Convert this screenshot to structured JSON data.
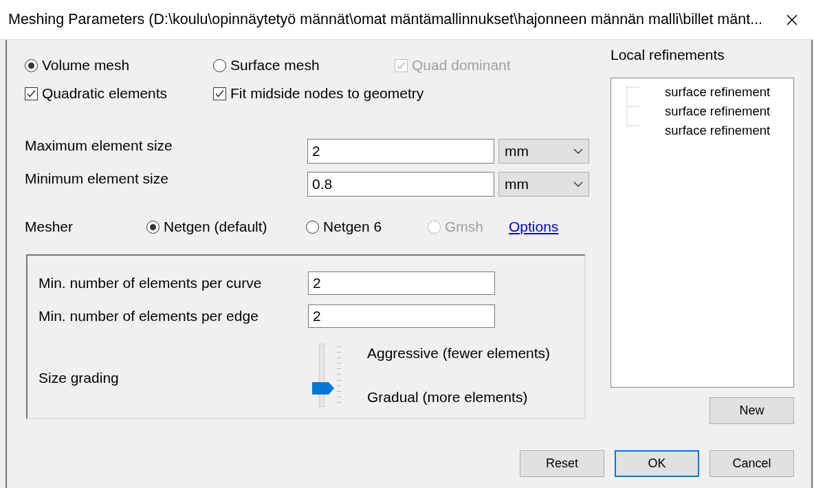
{
  "window": {
    "title": "Meshing Parameters (D:\\koulu\\opinnäytetyö männät\\omat mäntämallinnukset\\hajonneen männän malli\\billet mänt..."
  },
  "mesh_type": [
    {
      "kind": "radio",
      "label": "Volume mesh",
      "selected": true,
      "disabled": false
    },
    {
      "kind": "radio",
      "label": "Surface mesh",
      "selected": false,
      "disabled": false
    },
    {
      "kind": "checkbox",
      "label": "Quad dominant",
      "checked": true,
      "disabled": true
    }
  ],
  "options": [
    {
      "label": "Quadratic elements",
      "checked": true
    },
    {
      "label": "Fit midside nodes to geometry",
      "checked": true
    }
  ],
  "sizes": [
    {
      "label": "Maximum element size",
      "value": "2",
      "unit": "mm"
    },
    {
      "label": "Minimum element size",
      "value": "0.8",
      "unit": "mm"
    }
  ],
  "mesher": {
    "label": "Mesher",
    "choices": [
      {
        "label": "Netgen (default)",
        "selected": true,
        "disabled": false
      },
      {
        "label": "Netgen 6",
        "selected": false,
        "disabled": false
      },
      {
        "label": "Gmsh",
        "selected": false,
        "disabled": true
      }
    ],
    "link": "Options"
  },
  "netgen": {
    "fields": [
      {
        "label": "Min. number of elements per curve",
        "value": "2"
      },
      {
        "label": "Min. number of elements per edge",
        "value": "2"
      }
    ],
    "grading": {
      "label": "Size grading",
      "level": 0.3,
      "high": "Aggressive (fewer elements)",
      "low": "Gradual (more elements)"
    }
  },
  "refinements": {
    "title": "Local refinements",
    "items": [
      "surface refinement",
      "surface refinement",
      "surface refinement"
    ],
    "new_button": "New"
  },
  "buttons": [
    {
      "label": "Reset",
      "default": false
    },
    {
      "label": "OK",
      "default": true
    },
    {
      "label": "Cancel",
      "default": false
    }
  ]
}
